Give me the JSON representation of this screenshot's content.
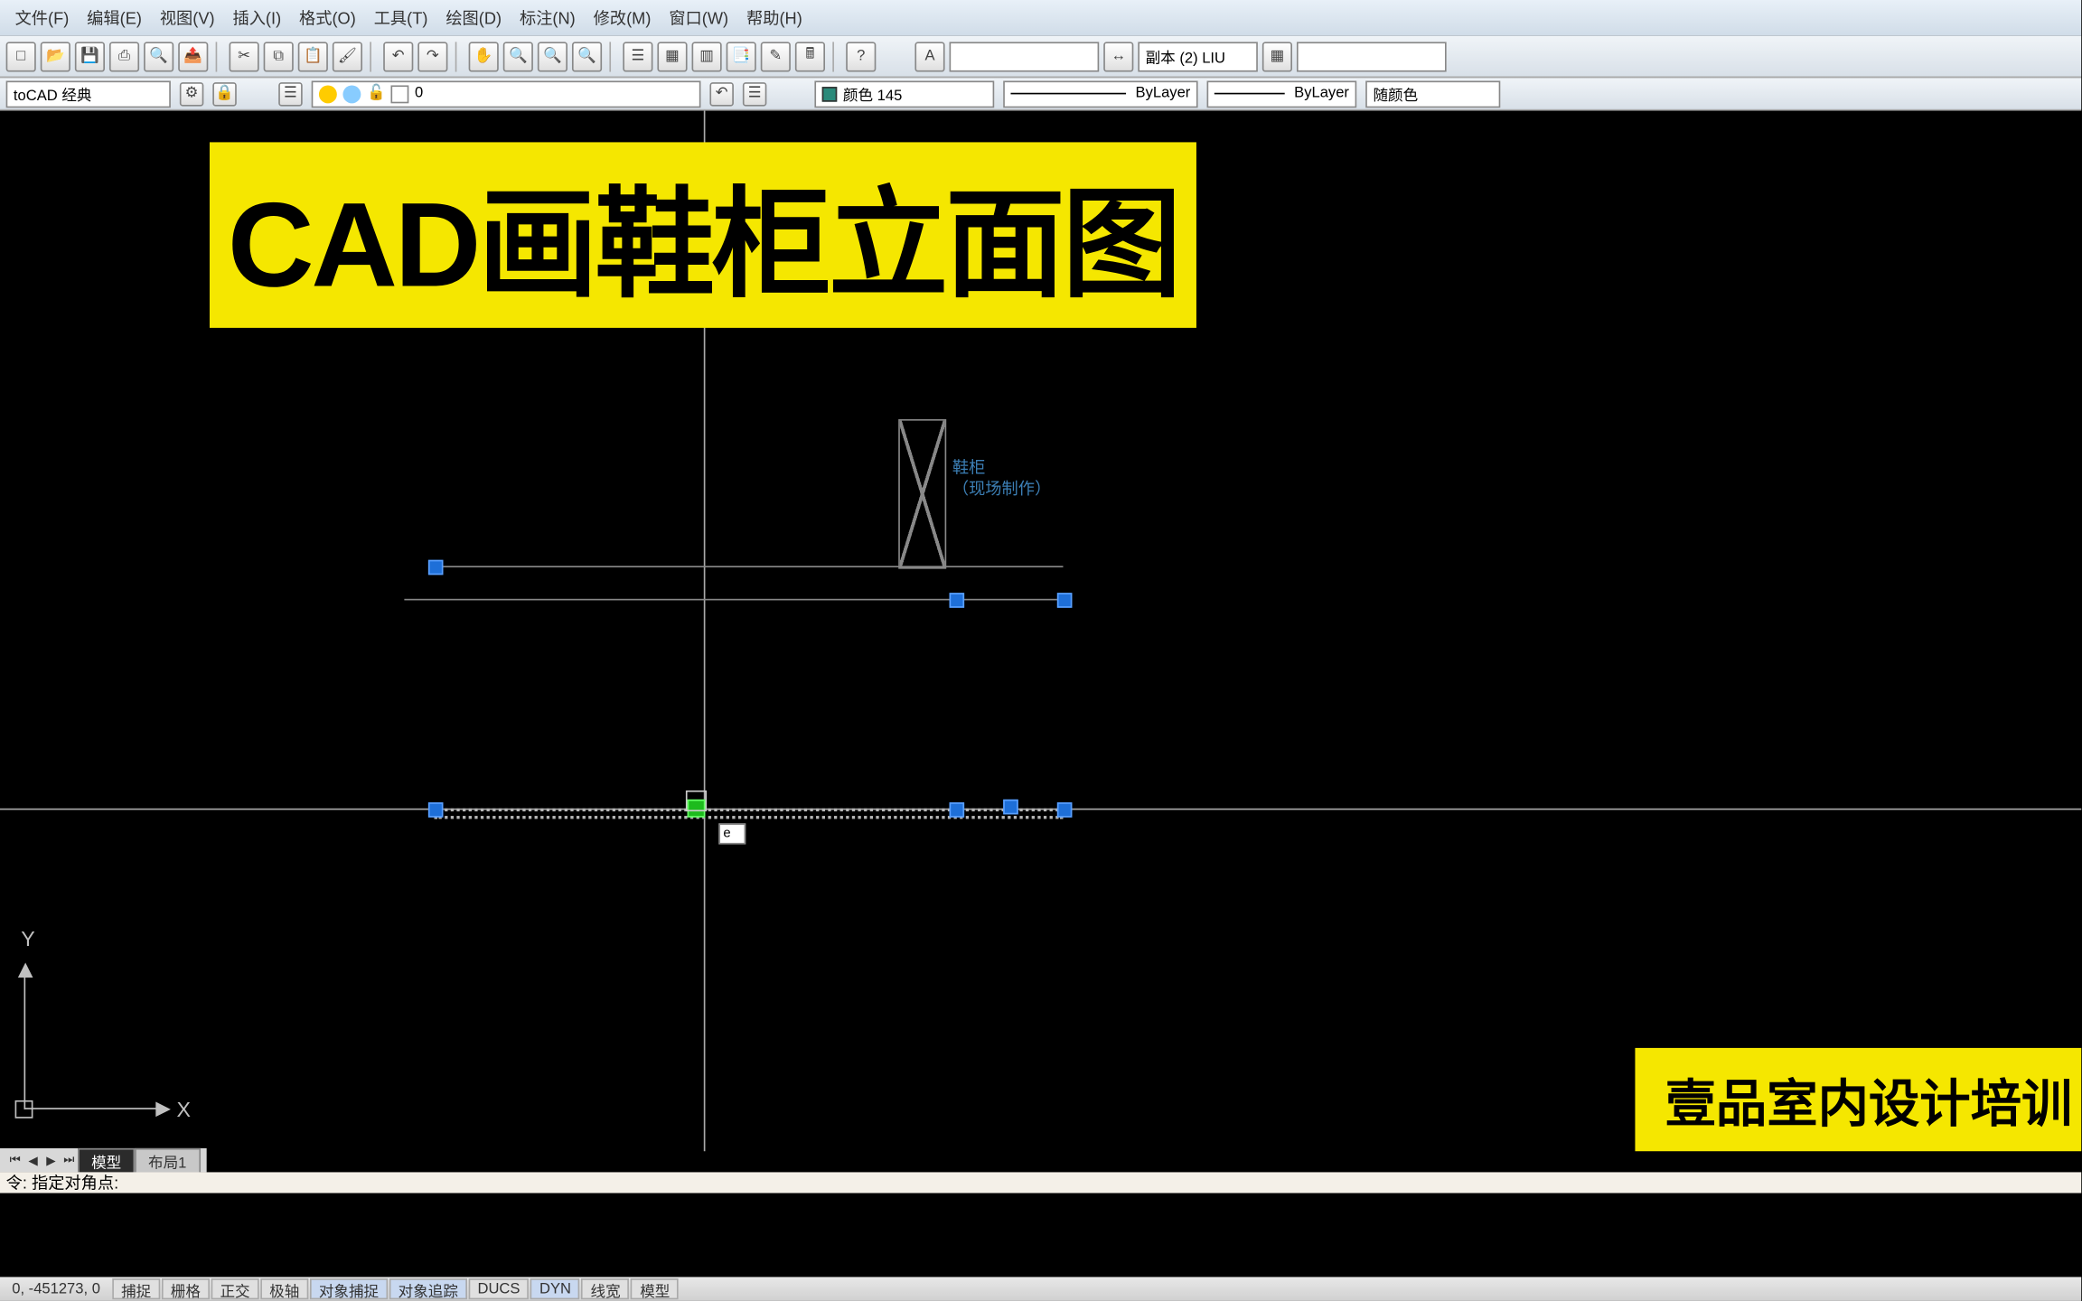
{
  "menu": {
    "items": [
      "文件(F)",
      "编辑(E)",
      "视图(V)",
      "插入(I)",
      "格式(O)",
      "工具(T)",
      "绘图(D)",
      "标注(N)",
      "修改(M)",
      "窗口(W)",
      "帮助(H)"
    ]
  },
  "toolbar1": {
    "text_style": "副本 (2) LIU"
  },
  "toolbar2": {
    "workspace": "toCAD 经典",
    "layer_name": "0",
    "color": "颜色 145",
    "linetype": "ByLayer",
    "lineweight": "ByLayer",
    "plotstyle": "随颜色"
  },
  "title_overlay": "CAD画鞋柜立面图",
  "watermark": "壹品室内设计培训",
  "cabinet": {
    "label_line1": "鞋柜",
    "label_line2": "（现场制作）"
  },
  "ucs": {
    "x": "X",
    "y": "Y"
  },
  "ml_tabs": {
    "model": "模型",
    "layout": "布局1"
  },
  "command": {
    "prompt": "令: 指定对角点:"
  },
  "dynamic_input": "e",
  "status": {
    "coords": "0, -451273, 0",
    "buttons": [
      "捕捉",
      "栅格",
      "正交",
      "极轴",
      "对象捕捉",
      "对象追踪",
      "DUCS",
      "DYN",
      "线宽",
      "模型"
    ]
  }
}
